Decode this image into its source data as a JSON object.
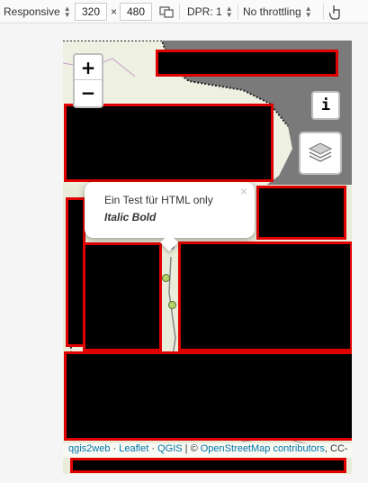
{
  "toolbar": {
    "device": "Responsive",
    "width": "320",
    "times": "×",
    "height": "480",
    "dpr": "DPR: 1",
    "throttling": "No throttling"
  },
  "map": {
    "zoom_in": "+",
    "zoom_out": "−",
    "info": "i",
    "popup": {
      "line1": "Ein Test für HTML only",
      "line2": "Italic Bold",
      "close": "×"
    },
    "attribution": {
      "qgis2web": "qgis2web",
      "sep1": " · ",
      "leaflet": "Leaflet",
      "sep2": " · ",
      "qgis": "QGIS",
      "sep3": " | © ",
      "osm": "OpenStreetMap contributors",
      "tail": ", CC-"
    }
  }
}
